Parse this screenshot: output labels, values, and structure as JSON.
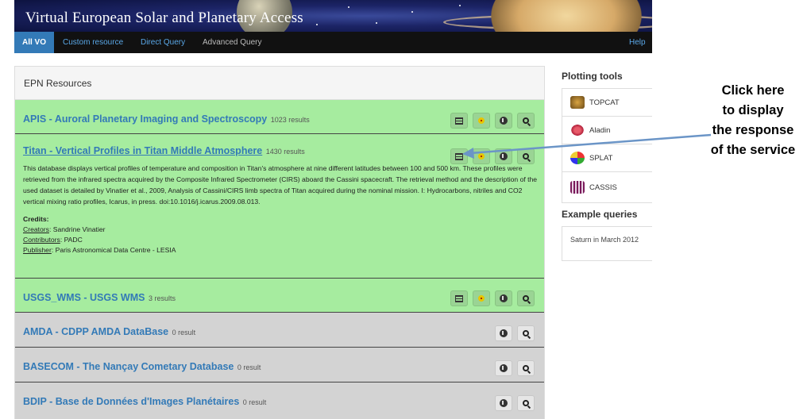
{
  "banner": {
    "title": "Virtual European Solar and Planetary Access"
  },
  "nav": {
    "tabs": [
      {
        "label": "All VO",
        "active": true
      },
      {
        "label": "Custom resource"
      },
      {
        "label": "Direct Query"
      },
      {
        "label": "Advanced Query"
      }
    ],
    "help": "Help"
  },
  "panel": {
    "heading": "EPN Resources",
    "resources": [
      {
        "title": "APIS - Auroral Planetary Imaging and Spectroscopy",
        "count": "1023 results"
      },
      {
        "title": "Titan - Vertical Profiles in Titan Middle Atmosphere",
        "count": "1430 results",
        "description": "This database displays vertical profiles of temperature and composition in Titan's atmosphere at nine different latitudes between 100 and 500 km. These profiles were retrieved from the infrared spectra acquired by the Composite Infrared Spectrometer (CIRS) aboard the Cassini spacecraft. The retrieval method and the description of the used dataset is detailed by Vinatier et al., 2009, Analysis of Cassini/CIRS limb spectra of Titan acquired during the nominal mission. I: Hydrocarbons, nitriles and CO2 vertical mixing ratio profiles, Icarus, in press. doi:10.1016/j.icarus.2009.08.013.",
        "credits_label": "Credits:",
        "creators_label": "Creators",
        "creators": ": Sandrine Vinatier",
        "contributors_label": "Contributors",
        "contributors": ": PADC",
        "publisher_label": "Publisher",
        "publisher": ": Paris Astronomical Data Centre - LESIA"
      },
      {
        "title": "USGS_WMS - USGS WMS",
        "count": "3 results"
      },
      {
        "title": "AMDA - CDPP AMDA DataBase",
        "count": "0 result"
      },
      {
        "title": "BASECOM - The Nançay Cometary Database",
        "count": "0 result"
      },
      {
        "title": "BDIP - Base de Données d'Images Planétaires",
        "count": "0 result"
      }
    ]
  },
  "sidebar": {
    "plotting_heading": "Plotting tools",
    "tools": [
      "TOPCAT",
      "Aladin",
      "SPLAT",
      "CASSIS"
    ],
    "examples_heading": "Example queries",
    "example": "Saturn in March 2012"
  },
  "callout": {
    "lines": [
      "Click here",
      "to display",
      "the response",
      "of the service"
    ],
    "arrow_color": "#6b95c7"
  },
  "colors": {
    "green_row": "#a6ec9f",
    "grey_row": "#d3d3d3",
    "link": "#337ab7",
    "nav_bg": "#111111"
  }
}
